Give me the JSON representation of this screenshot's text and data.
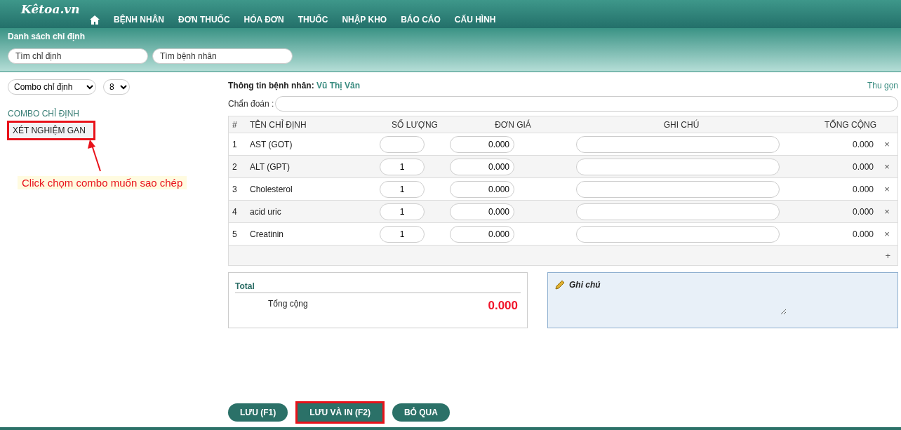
{
  "header": {
    "logo": "Kêtoa.vn",
    "nav": [
      "BỆNH NHÂN",
      "ĐƠN THUỐC",
      "HÓA ĐƠN",
      "THUỐC",
      "NHẬP KHO",
      "BÁO CÁO",
      "CẤU HÌNH"
    ]
  },
  "page_title": "Danh sách chỉ định",
  "searches": [
    {
      "placeholder": "Tìm chỉ định"
    },
    {
      "placeholder": "Tìm bệnh nhân"
    }
  ],
  "sidebar": {
    "selects": [
      "Combo chỉ định",
      "8"
    ],
    "section": "COMBO CHỈ ĐỊNH",
    "items": [
      {
        "label": "XÉT NGHIỆM GAN",
        "selected": true,
        "highlighted": true
      }
    ]
  },
  "annotation": {
    "text": "Click chọm combo muốn sao chép"
  },
  "patient": {
    "label": "Thông tin bệnh nhân:",
    "name": "Vũ Thị Vân",
    "collapse": "Thu gọn"
  },
  "diagnosis": {
    "label": "Chẩn đoán :"
  },
  "table": {
    "columns": [
      "#",
      "TÊN CHỈ ĐỊNH",
      "SỐ LƯỢNG",
      "ĐƠN GIÁ",
      "GHI CHÚ",
      "TỔNG CỘNG"
    ],
    "rows": [
      {
        "index": "1",
        "name": "AST (GOT)",
        "price": "0.000",
        "total": "0.000"
      },
      {
        "index": "2",
        "name": "ALT (GPT)",
        "quantity": "1",
        "price": "0.000",
        "total": "0.000"
      },
      {
        "index": "3",
        "name": "Cholesterol",
        "quantity": "1",
        "price": "0.000",
        "total": "0.000"
      },
      {
        "index": "4",
        "name": "acid uric",
        "quantity": "1",
        "price": "0.000",
        "total": "0.000"
      },
      {
        "index": "5",
        "name": "Creatinin",
        "quantity": "1",
        "price": "0.000",
        "total": "0.000"
      }
    ],
    "remove": "×",
    "add": "+"
  },
  "total_box": {
    "title": "Total",
    "label": "Tổng cộng",
    "value": "0.000"
  },
  "note_box": {
    "title": "Ghi chú"
  },
  "buttons": [
    {
      "label": "LƯU (F1)",
      "highlighted": false
    },
    {
      "label": "LƯU VÀ IN (F2)",
      "highlighted": true
    },
    {
      "label": "BỎ QUA",
      "highlighted": false
    }
  ]
}
